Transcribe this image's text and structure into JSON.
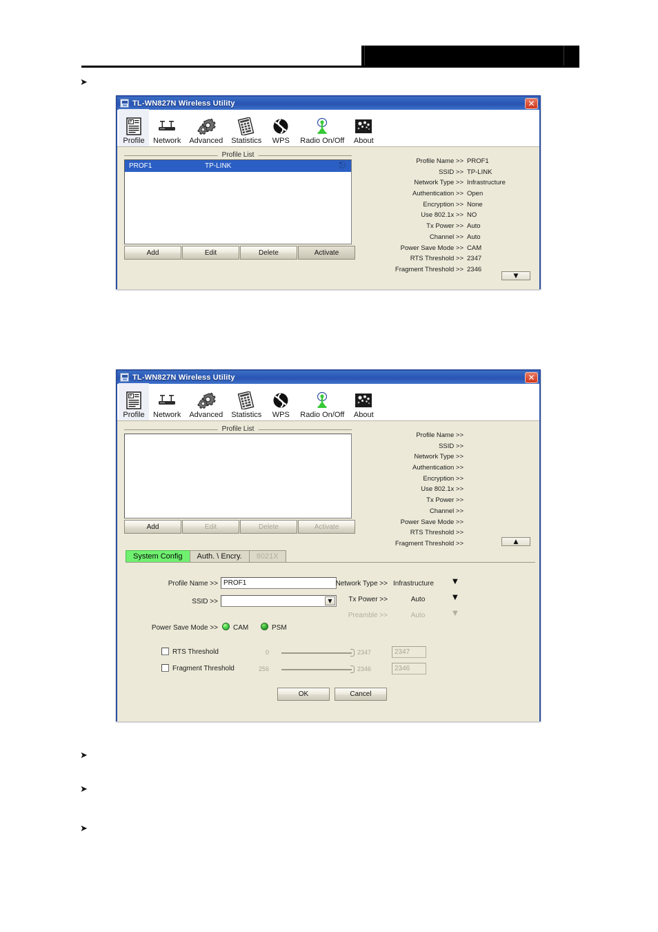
{
  "page": {
    "header_redaction": true,
    "bullets": [
      "arrow-bullet",
      "arrow-bullet",
      "arrow-bullet",
      "arrow-bullet"
    ],
    "bullet_glyph": "➤"
  },
  "window": {
    "title": "TL-WN827N Wireless Utility",
    "close_label": "✕",
    "toolbar": [
      {
        "label": "Profile",
        "icon": "profile-icon"
      },
      {
        "label": "Network",
        "icon": "network-icon"
      },
      {
        "label": "Advanced",
        "icon": "advanced-gear-icon"
      },
      {
        "label": "Statistics",
        "icon": "statistics-icon"
      },
      {
        "label": "WPS",
        "icon": "wps-icon"
      },
      {
        "label": "Radio On/Off",
        "icon": "radio-onoff-icon"
      },
      {
        "label": "About",
        "icon": "about-icon"
      }
    ],
    "group_legend": "Profile List",
    "buttons": {
      "add": "Add",
      "edit": "Edit",
      "delete": "Delete",
      "activate": "Activate"
    }
  },
  "window1": {
    "profile_rows": [
      {
        "name": "PROF1",
        "ssid": "TP-LINK",
        "icon": "connected-plug-icon"
      }
    ],
    "buttons_enabled": {
      "add": true,
      "edit": true,
      "delete": true,
      "activate": true
    },
    "scroll_button": "▼",
    "details": [
      {
        "label": "Profile Name >>",
        "value": "PROF1"
      },
      {
        "label": "SSID >>",
        "value": "TP-LINK"
      },
      {
        "label": "Network Type >>",
        "value": "Infrastructure"
      },
      {
        "label": "Authentication >>",
        "value": "Open"
      },
      {
        "label": "Encryption >>",
        "value": "None"
      },
      {
        "label": "Use 802.1x >>",
        "value": "NO"
      },
      {
        "label": "Tx Power >>",
        "value": "Auto"
      },
      {
        "label": "Channel >>",
        "value": "Auto"
      },
      {
        "label": "Power Save Mode >>",
        "value": "CAM"
      },
      {
        "label": "RTS Threshold >>",
        "value": "2347"
      },
      {
        "label": "Fragment Threshold >>",
        "value": "2346"
      }
    ]
  },
  "window2": {
    "profile_rows": [],
    "buttons_enabled": {
      "add": true,
      "edit": false,
      "delete": false,
      "activate": false
    },
    "scroll_button": "▲",
    "details": [
      {
        "label": "Profile Name >>",
        "value": ""
      },
      {
        "label": "SSID >>",
        "value": ""
      },
      {
        "label": "Network Type >>",
        "value": ""
      },
      {
        "label": "Authentication >>",
        "value": ""
      },
      {
        "label": "Encryption >>",
        "value": ""
      },
      {
        "label": "Use 802.1x >>",
        "value": ""
      },
      {
        "label": "Tx Power >>",
        "value": ""
      },
      {
        "label": "Channel >>",
        "value": ""
      },
      {
        "label": "Power Save Mode >>",
        "value": ""
      },
      {
        "label": "RTS Threshold >>",
        "value": ""
      },
      {
        "label": "Fragment Threshold >>",
        "value": ""
      }
    ],
    "tabs": [
      {
        "label": "System Config",
        "state": "active"
      },
      {
        "label": "Auth. \\ Encry.",
        "state": "normal"
      },
      {
        "label": "8021X",
        "state": "disabled"
      }
    ],
    "form": {
      "profile_name_label": "Profile Name >>",
      "profile_name_value": "PROF1",
      "ssid_label": "SSID >>",
      "ssid_value": "",
      "ssid_arrow": "▼",
      "network_type_label": "Network Type >>",
      "network_type_value": "Infrastructure",
      "network_type_arrow": "▼",
      "tx_power_label": "Tx Power >>",
      "tx_power_value": "Auto",
      "tx_power_arrow": "▼",
      "preamble_label": "Preamble >>",
      "preamble_value": "Auto",
      "preamble_arrow": "▼",
      "power_save_label": "Power Save Mode >>",
      "power_save_cam": "CAM",
      "power_save_psm": "PSM",
      "rts_label": "RTS Threshold",
      "rts_min": "0",
      "rts_max": "2347",
      "rts_value": "2347",
      "frag_label": "Fragment Threshold",
      "frag_min": "256",
      "frag_max": "2346",
      "frag_value": "2346",
      "ok_label": "OK",
      "cancel_label": "Cancel"
    }
  },
  "colors": {
    "title_blue": "#2b59b8",
    "window_face": "#ece9d8",
    "selection_blue": "#2b5fc4",
    "tab_active_green": "#6ff06f",
    "close_red": "#d0381d"
  }
}
